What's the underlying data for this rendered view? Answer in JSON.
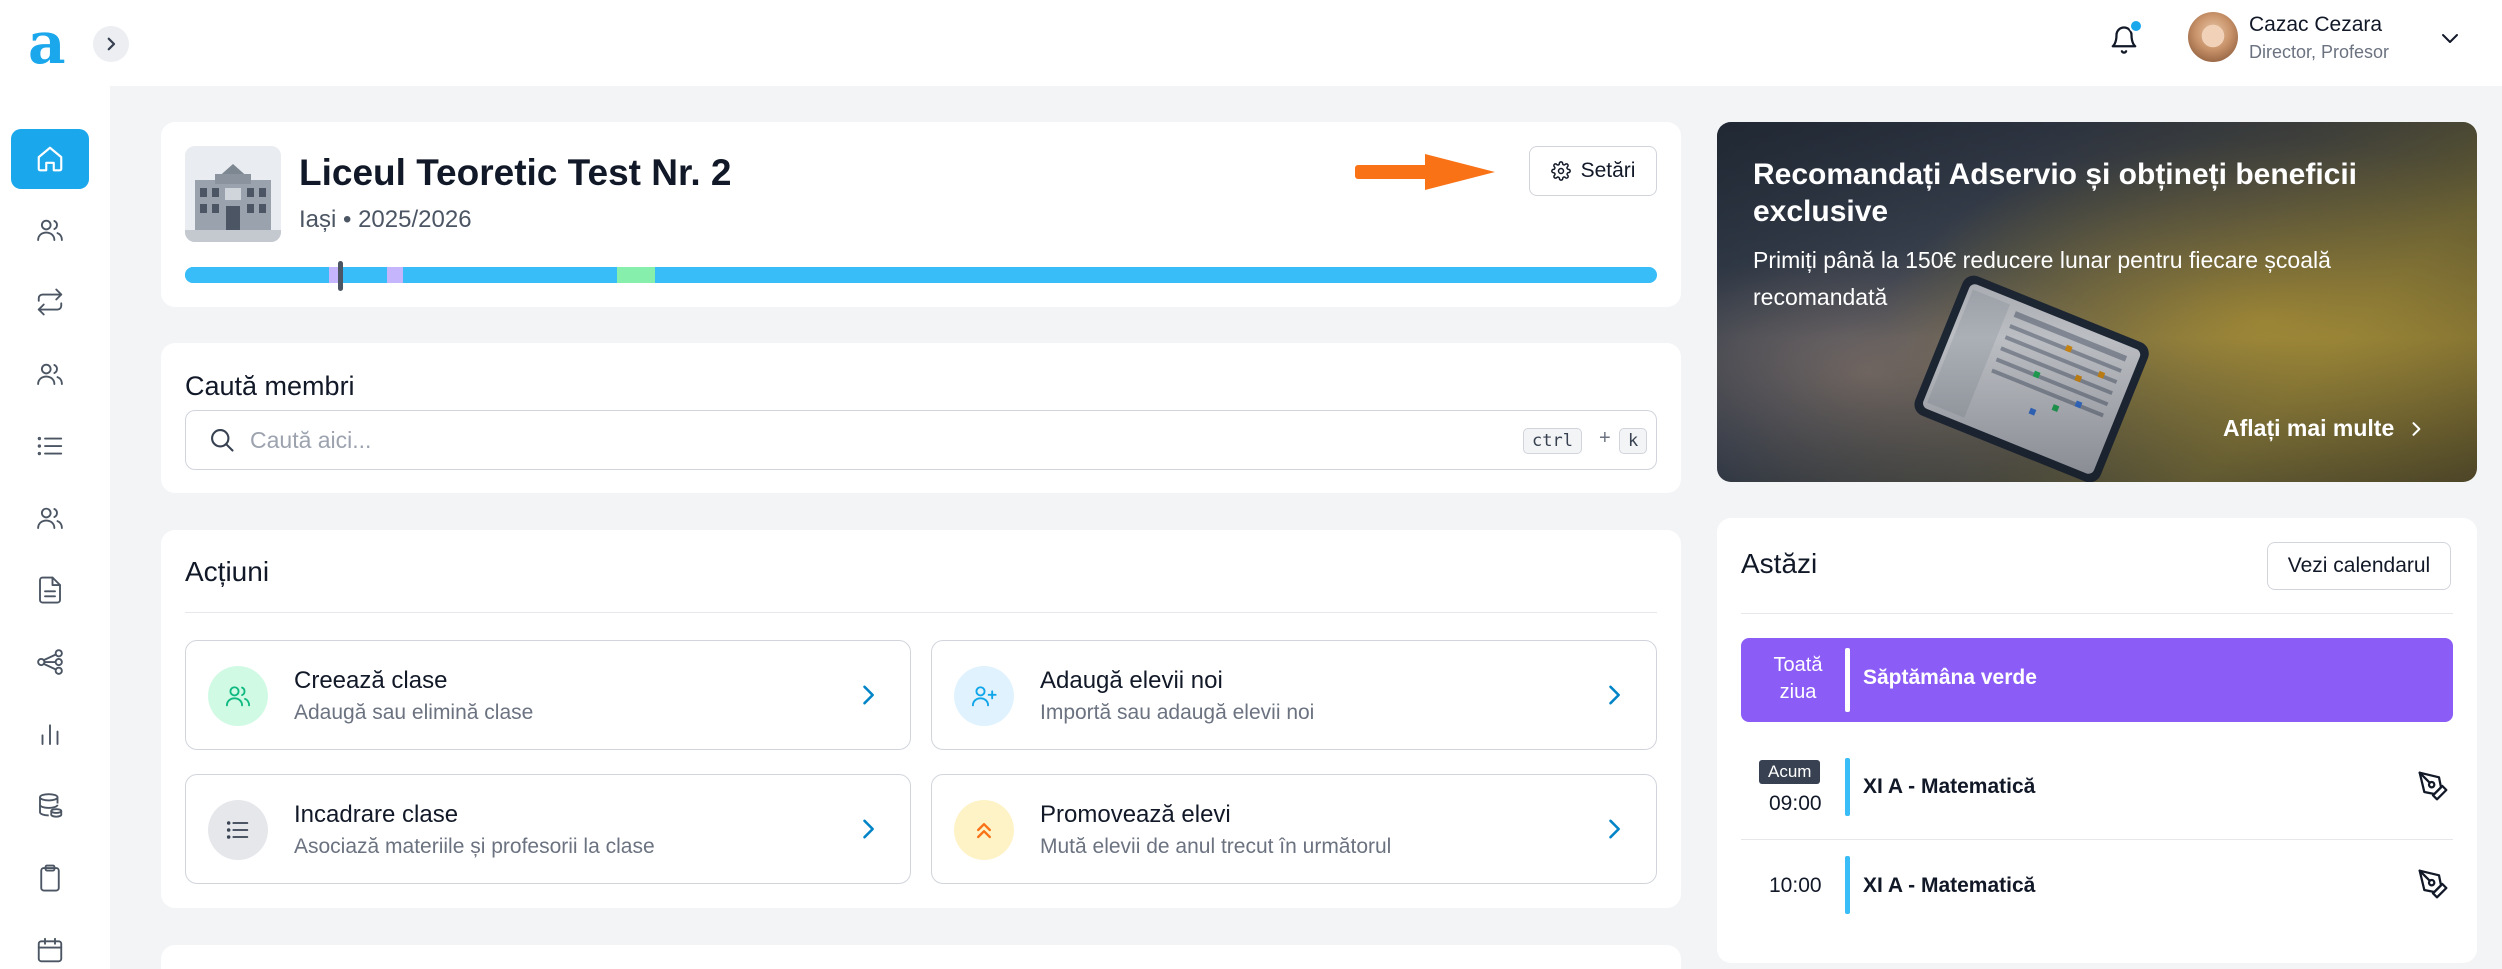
{
  "topbar": {
    "logo": "a",
    "user": {
      "name": "Cazac Cezara",
      "role": "Director, Profesor"
    }
  },
  "sidebar": {
    "items": [
      {
        "name": "home-icon",
        "active": true
      },
      {
        "name": "users-icon"
      },
      {
        "name": "transfer-icon"
      },
      {
        "name": "group-icon"
      },
      {
        "name": "list-icon"
      },
      {
        "name": "students-icon"
      },
      {
        "name": "document-icon"
      },
      {
        "name": "share-icon"
      },
      {
        "name": "chart-icon"
      },
      {
        "name": "database-icon"
      },
      {
        "name": "clipboard-icon"
      },
      {
        "name": "calendar-icon"
      }
    ]
  },
  "school": {
    "title": "Liceul Teoretic Test Nr. 2",
    "subtitle": "Iași • 2025/2026",
    "settings_label": "Setări",
    "progress_colors": {
      "base": "#38bdf8",
      "purple": "#c4b5fd",
      "green": "#86efac"
    }
  },
  "search": {
    "title": "Caută membri",
    "placeholder": "Caută aici...",
    "shortcut_key1": "ctrl",
    "shortcut_plus": "+",
    "shortcut_key2": "k"
  },
  "actions": {
    "title": "Acțiuni",
    "items": [
      {
        "title": "Creează clase",
        "desc": "Adaugă sau elimină clase",
        "icon": "users-icon"
      },
      {
        "title": "Adaugă elevii noi",
        "desc": "Importă sau adaugă elevii noi",
        "icon": "user-plus-icon"
      },
      {
        "title": "Incadrare clase",
        "desc": "Asociază materiile și profesorii la clase",
        "icon": "list-icon"
      },
      {
        "title": "Promovează elevi",
        "desc": "Mută elevii de anul trecut în următorul",
        "icon": "double-chevron-up-icon"
      }
    ]
  },
  "promo": {
    "title": "Recomandați Adservio și obțineți beneficii exclusive",
    "text": "Primiți până la 150€ reducere lunar pentru fiecare școală recomandată",
    "link": "Aflați mai multe"
  },
  "today": {
    "title": "Astăzi",
    "calendar_label": "Vezi calendarul",
    "allday_label": "Toată ziua",
    "allday_event": "Săptămâna verde",
    "allday_color": "#8b5cf6",
    "events": [
      {
        "now": "Acum",
        "time": "09:00",
        "name": "XI A - Matematică"
      },
      {
        "time": "10:00",
        "name": "XI A - Matematică"
      }
    ]
  }
}
